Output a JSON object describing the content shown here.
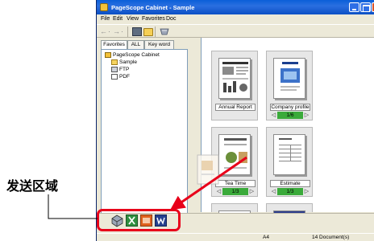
{
  "window": {
    "title": "PageScope Cabinet - Sample"
  },
  "menu": [
    "File",
    "Edit",
    "View",
    "Favorites",
    "Doc"
  ],
  "toolbar": {
    "back_glyph": "←",
    "forward_glyph": "→",
    "dropdown_glyph": "·",
    "icons": [
      "back-icon",
      "forward-icon",
      "grid-view-icon",
      "folder-icon",
      "favorites-icon"
    ]
  },
  "tabs": [
    "Favorites",
    "ALL",
    "Key word"
  ],
  "tree": {
    "root": "PageScope Cabinet",
    "children": [
      "Sample",
      "FTP",
      "PDF"
    ]
  },
  "documents": [
    {
      "label": "Annual Report",
      "page": null
    },
    {
      "label": "Company profile",
      "page": "1/6"
    },
    {
      "label": "Tea Time",
      "page": "1/3"
    },
    {
      "label": "Estimate",
      "page": "1/3"
    }
  ],
  "send_icons": [
    "send-device-icon",
    "excel-icon",
    "presentation-icon",
    "word-icon"
  ],
  "status": {
    "paper": "A4",
    "count": "14 Document(s)"
  },
  "annotation": {
    "label": "发送区域",
    "color": "#e8001a"
  }
}
